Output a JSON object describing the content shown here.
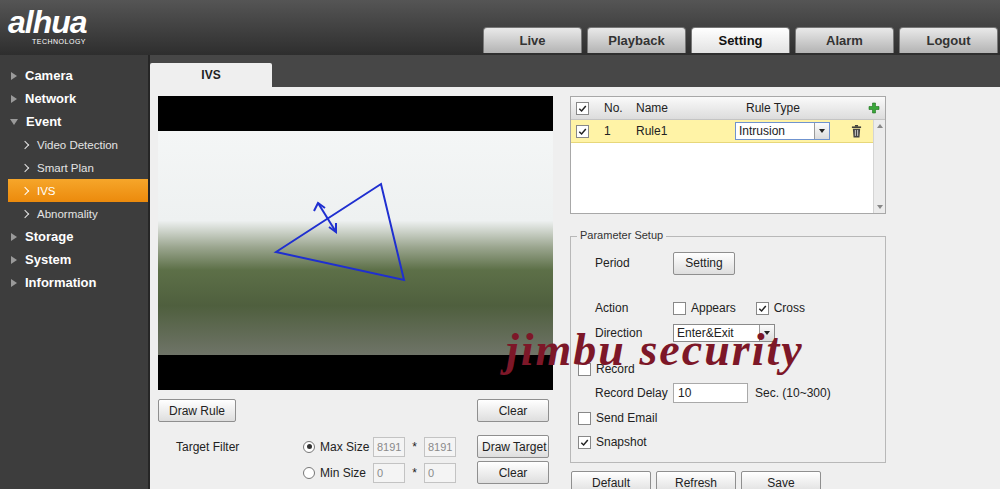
{
  "logo": {
    "brand": "alhua",
    "sub": "TECHNOLOGY"
  },
  "nav_tabs": [
    {
      "label": "Live",
      "selected": false
    },
    {
      "label": "Playback",
      "selected": false
    },
    {
      "label": "Setting",
      "selected": true
    },
    {
      "label": "Alarm",
      "selected": false
    },
    {
      "label": "Logout",
      "selected": false
    }
  ],
  "sidebar": [
    {
      "label": "Camera",
      "expanded": false,
      "selected": false,
      "children": []
    },
    {
      "label": "Network",
      "expanded": false,
      "selected": false,
      "children": []
    },
    {
      "label": "Event",
      "expanded": true,
      "selected": false,
      "children": [
        {
          "label": "Video Detection",
          "selected": false
        },
        {
          "label": "Smart Plan",
          "selected": false
        },
        {
          "label": "IVS",
          "selected": true
        },
        {
          "label": "Abnormality",
          "selected": false
        }
      ]
    },
    {
      "label": "Storage",
      "expanded": false,
      "selected": false,
      "children": []
    },
    {
      "label": "System",
      "expanded": false,
      "selected": false,
      "children": []
    },
    {
      "label": "Information",
      "expanded": false,
      "selected": false,
      "children": []
    }
  ],
  "page_tab": "IVS",
  "video_buttons": [
    "Draw Rule",
    "Clear"
  ],
  "target_filter": {
    "label": "Target Filter",
    "separator": "*",
    "options": [
      {
        "label": "Max Size",
        "selected": true,
        "disabled": true,
        "width": "8191",
        "height": "8191",
        "button": "Draw Target"
      },
      {
        "label": "Min Size",
        "selected": false,
        "disabled": true,
        "width": "0",
        "height": "0",
        "button": "Clear"
      }
    ]
  },
  "rules_table": {
    "all_checked": true,
    "columns": [
      "No.",
      "Name",
      "Rule Type"
    ],
    "rows": [
      {
        "checked": true,
        "no": "1",
        "name": "Rule1",
        "type": "Intrusion",
        "selected": true
      }
    ]
  },
  "parameter_setup": {
    "title": "Parameter Setup",
    "period": {
      "label": "Period",
      "button": "Setting"
    },
    "action": {
      "label": "Action",
      "options": [
        {
          "label": "Appears",
          "checked": false
        },
        {
          "label": "Cross",
          "checked": true
        }
      ]
    },
    "direction": {
      "label": "Direction",
      "value": "Enter&Exit"
    },
    "record": {
      "label": "Record",
      "checked": false
    },
    "record_delay": {
      "label": "Record Delay",
      "value": "10",
      "hint": "Sec. (10~300)"
    },
    "send_email": {
      "label": "Send Email",
      "checked": false
    },
    "snapshot": {
      "label": "Snapshot",
      "checked": true
    }
  },
  "footer_buttons": [
    "Default",
    "Refresh",
    "Save"
  ],
  "watermark": "jimbu security"
}
